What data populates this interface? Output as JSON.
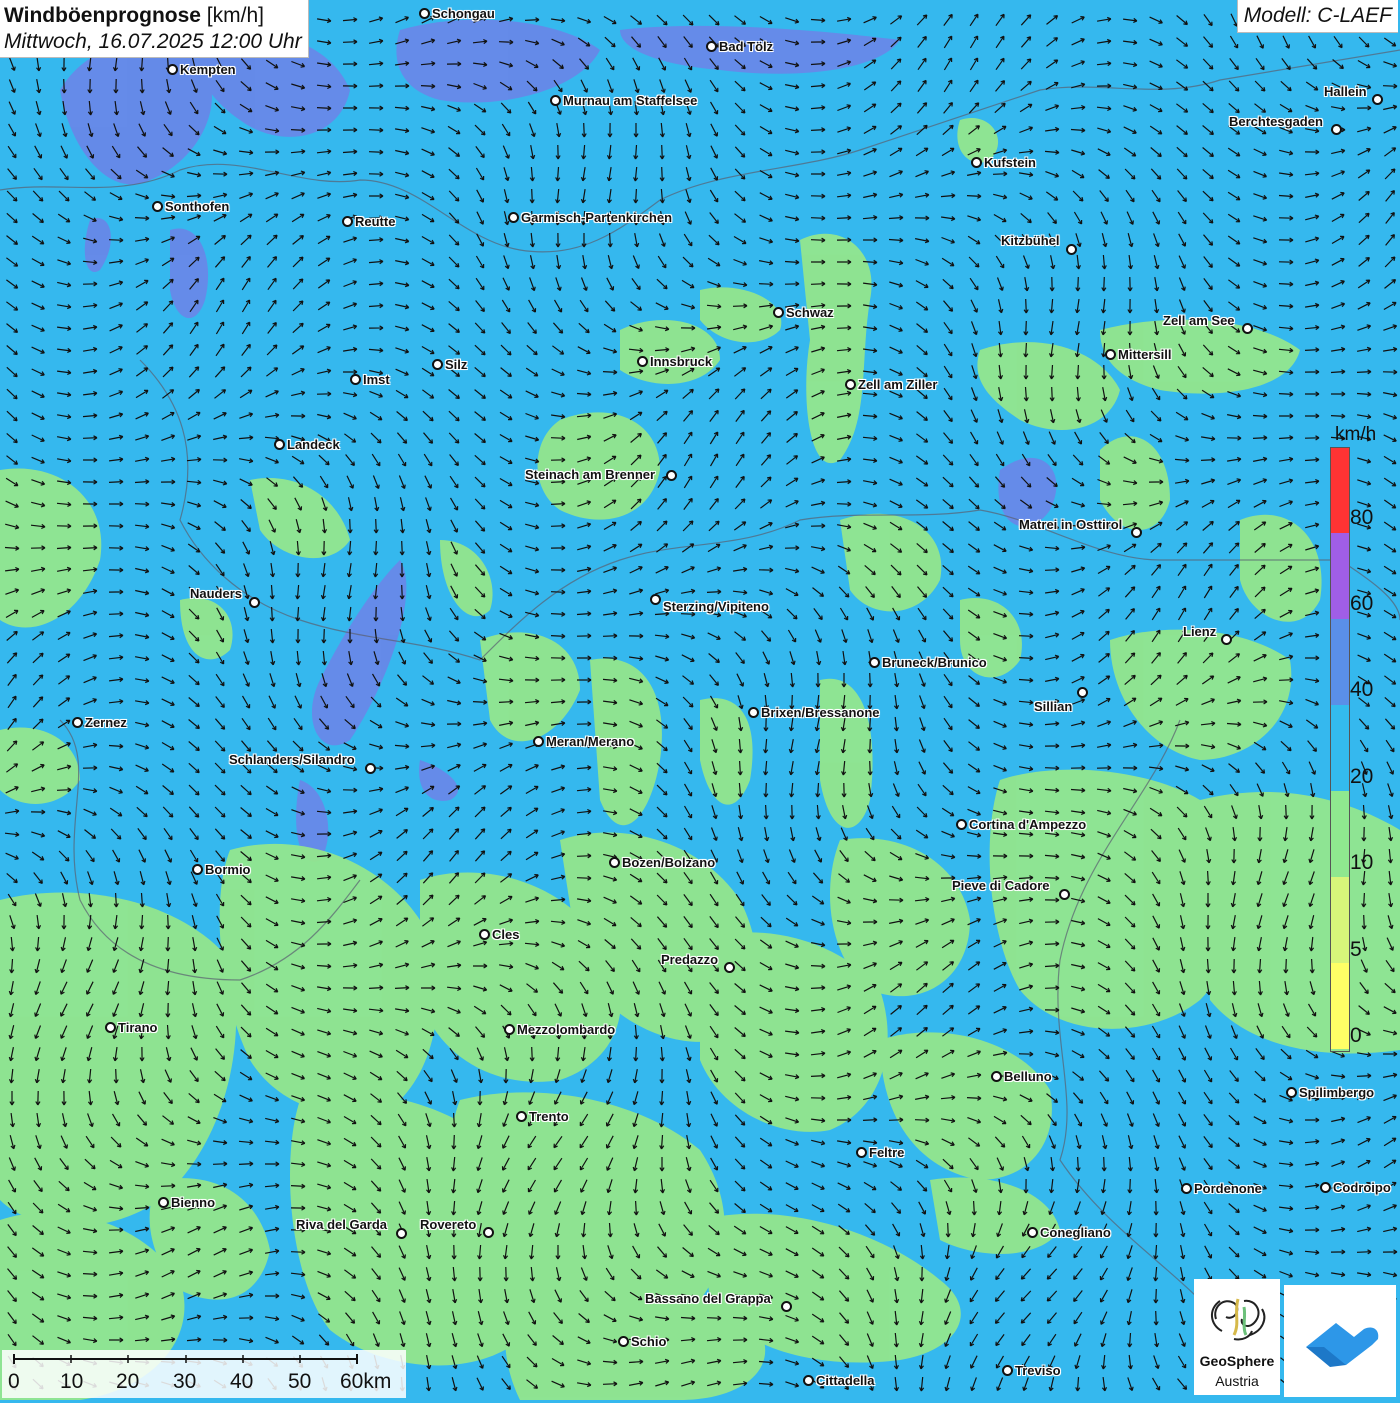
{
  "header": {
    "title_bold": "Windböenprognose",
    "title_unit": " [km/h]",
    "subtitle": "Mittwoch, 16.07.2025 12:00 Uhr"
  },
  "model_label": "Modell: C-LAEF",
  "legend": {
    "unit": "km/h",
    "ticks": [
      "80",
      "60",
      "40",
      "20",
      "10",
      "5",
      "0"
    ],
    "colors": [
      "#ff3333",
      "#a05ee6",
      "#5a8fe8",
      "#33bbee",
      "#8fe88f",
      "#d8f57a",
      "#ffff66"
    ]
  },
  "scalebar": {
    "labels": [
      "0",
      "10",
      "20",
      "30",
      "40",
      "50",
      "60km"
    ]
  },
  "logos": {
    "geosphere_line1": "GeoSphere",
    "geosphere_line2": "Austria",
    "icons": [
      "geosphere-logo-icon",
      "weather-cloud-logo-icon"
    ]
  },
  "colors": {
    "wind_20_40": "#35b8ee",
    "wind_10_20": "#93e68d",
    "wind_40_60": "#6a86e8",
    "arrow": "#111111"
  },
  "cities": [
    {
      "name": "Schongau"
    },
    {
      "name": "Bad Tölz"
    },
    {
      "name": "Kempten"
    },
    {
      "name": "Murnau am Staffelsee"
    },
    {
      "name": "Hallein"
    },
    {
      "name": "Berchtesgaden"
    },
    {
      "name": "Kufstein"
    },
    {
      "name": "Sonthofen"
    },
    {
      "name": "Reutte"
    },
    {
      "name": "Garmisch-Partenkirchen"
    },
    {
      "name": "Kitzbühel"
    },
    {
      "name": "Schwaz"
    },
    {
      "name": "Zell am See"
    },
    {
      "name": "Innsbruck"
    },
    {
      "name": "Mittersill"
    },
    {
      "name": "Silz"
    },
    {
      "name": "Imst"
    },
    {
      "name": "Zell am Ziller"
    },
    {
      "name": "Landeck"
    },
    {
      "name": "Steinach am Brenner"
    },
    {
      "name": "Matrei in Osttirol"
    },
    {
      "name": "Nauders"
    },
    {
      "name": "Sterzing/Vipiteno"
    },
    {
      "name": "Lienz"
    },
    {
      "name": "Bruneck/Brunico"
    },
    {
      "name": "Sillian"
    },
    {
      "name": "Brixen/Bressanone"
    },
    {
      "name": "Zernez"
    },
    {
      "name": "Meran/Merano"
    },
    {
      "name": "Schlanders/Silandro"
    },
    {
      "name": "Cortina d'Ampezzo"
    },
    {
      "name": "Bozen/Bolzano"
    },
    {
      "name": "Bormio"
    },
    {
      "name": "Pieve di Cadore"
    },
    {
      "name": "Cles"
    },
    {
      "name": "Predazzo"
    },
    {
      "name": "Tirano"
    },
    {
      "name": "Mezzolombardo"
    },
    {
      "name": "Belluno"
    },
    {
      "name": "Spilimbergo"
    },
    {
      "name": "Trento"
    },
    {
      "name": "Feltre"
    },
    {
      "name": "Pordenone"
    },
    {
      "name": "Codroipo"
    },
    {
      "name": "Bienno"
    },
    {
      "name": "Riva del Garda"
    },
    {
      "name": "Rovereto"
    },
    {
      "name": "Conegliano"
    },
    {
      "name": "Bassano del Grappa"
    },
    {
      "name": "Schio"
    },
    {
      "name": "Treviso"
    },
    {
      "name": "Cittadella"
    }
  ]
}
